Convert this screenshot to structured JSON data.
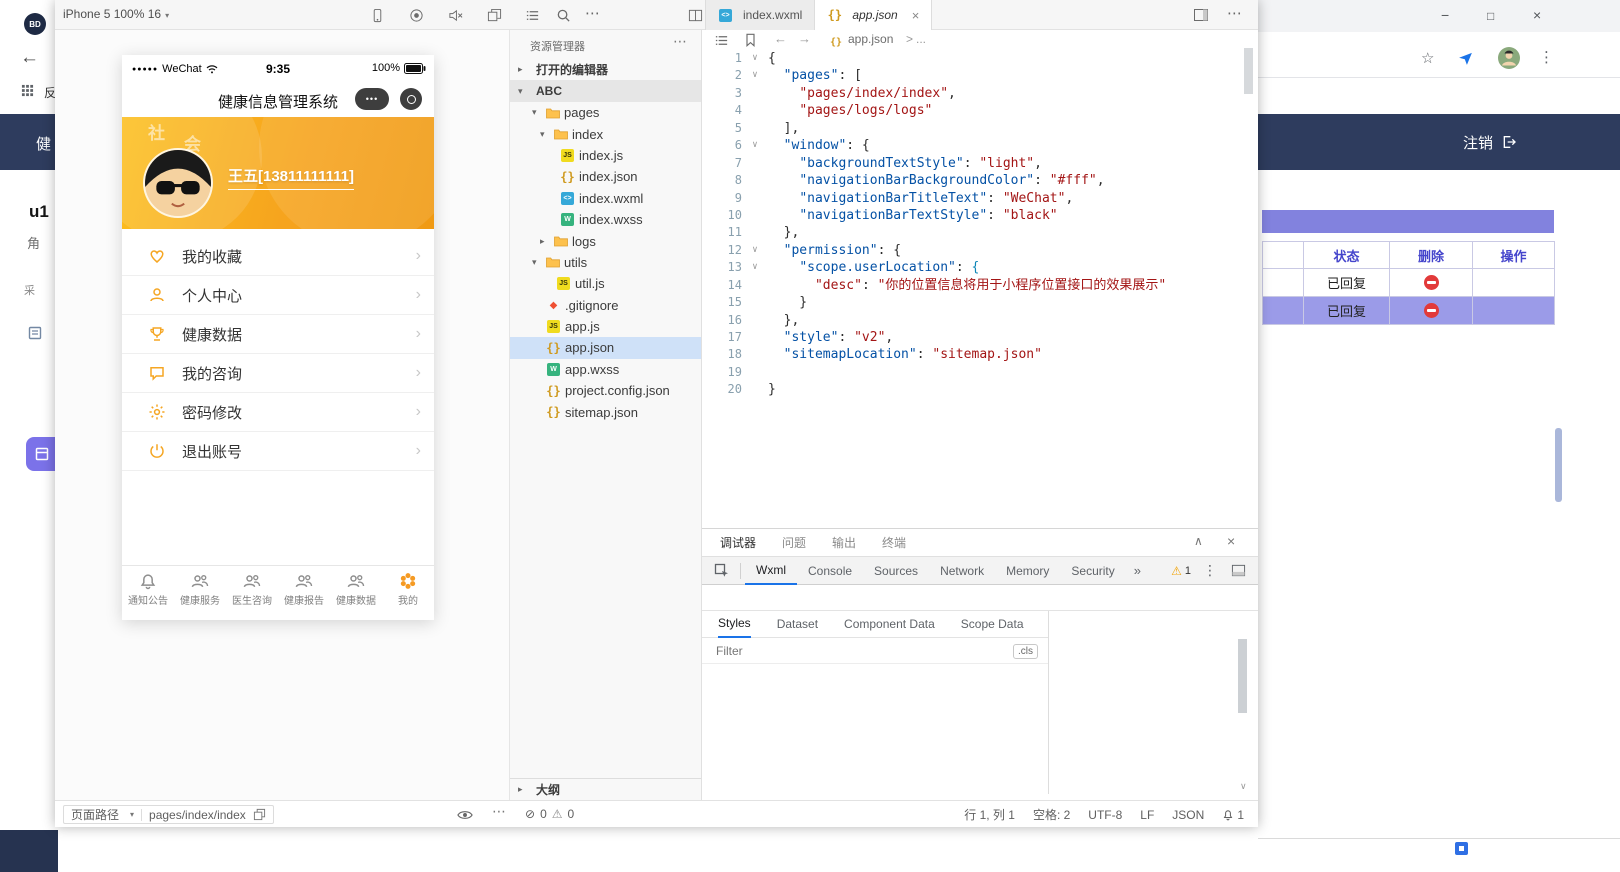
{
  "left_window": {
    "favicon_text": "BD",
    "bookmark_partial": "反",
    "page_header_partial": "健",
    "username_partial": "u1",
    "role_partial": "角",
    "small_partial": "采"
  },
  "topbar": {
    "device_selector": "iPhone 5 100% 16",
    "tabs": [
      {
        "label": "index.wxml",
        "type": "wxml",
        "active": false
      },
      {
        "label": "app.json",
        "type": "json",
        "active": true
      }
    ]
  },
  "simulator": {
    "status": {
      "carrier_dots": "●●●●●",
      "carrier": "WeChat",
      "time": "9:35",
      "battery": "100%"
    },
    "nav_title": "健康信息管理系统",
    "capsule_dots": "•••",
    "header": {
      "name": "王五[13811111111]",
      "decor1": "社",
      "decor2": "会"
    },
    "menu": [
      {
        "label": "我的收藏",
        "icon": "heart-icon"
      },
      {
        "label": "个人中心",
        "icon": "user-icon"
      },
      {
        "label": "健康数据",
        "icon": "trophy-icon"
      },
      {
        "label": "我的咨询",
        "icon": "chat-icon"
      },
      {
        "label": "密码修改",
        "icon": "gear-icon"
      },
      {
        "label": "退出账号",
        "icon": "power-icon"
      }
    ],
    "tabbar": [
      {
        "label": "通知公告",
        "icon": "bell-icon",
        "active": false
      },
      {
        "label": "健康服务",
        "icon": "people-icon",
        "active": false
      },
      {
        "label": "医生咨询",
        "icon": "people-icon",
        "active": false
      },
      {
        "label": "健康报告",
        "icon": "people-icon",
        "active": false
      },
      {
        "label": "健康数据",
        "icon": "people-icon",
        "active": false
      },
      {
        "label": "我的",
        "icon": "flower-icon",
        "active": true
      }
    ],
    "footer": {
      "path_label": "页面路径",
      "path_value": "pages/index/index"
    }
  },
  "explorer": {
    "title": "资源管理器",
    "open_editors": "打开的编辑器",
    "project": "ABC",
    "outline": "大纲",
    "tree": [
      {
        "label": "pages",
        "type": "folder",
        "indent": 22,
        "expanded": true
      },
      {
        "label": "index",
        "type": "folder",
        "indent": 30,
        "expanded": true
      },
      {
        "label": "index.js",
        "type": "js",
        "indent": 50
      },
      {
        "label": "index.json",
        "type": "json",
        "indent": 50
      },
      {
        "label": "index.wxml",
        "type": "wxml",
        "indent": 50
      },
      {
        "label": "index.wxss",
        "type": "wxss",
        "indent": 50
      },
      {
        "label": "logs",
        "type": "folder",
        "indent": 30,
        "expanded": false
      },
      {
        "label": "utils",
        "type": "folder",
        "indent": 22,
        "expanded": true
      },
      {
        "label": "util.js",
        "type": "js",
        "indent": 46
      },
      {
        "label": ".gitignore",
        "type": "git",
        "indent": 36
      },
      {
        "label": "app.js",
        "type": "js",
        "indent": 36
      },
      {
        "label": "app.json",
        "type": "json",
        "indent": 36,
        "selected": true
      },
      {
        "label": "app.wxss",
        "type": "wxss",
        "indent": 36
      },
      {
        "label": "project.config.json",
        "type": "json",
        "indent": 36
      },
      {
        "label": "sitemap.json",
        "type": "json",
        "indent": 36
      }
    ]
  },
  "editor": {
    "breadcrumb": {
      "file": "app.json",
      "sep": ">",
      "more": "..."
    },
    "code": [
      {
        "n": 1,
        "fold": true,
        "tokens": [
          [
            "p",
            "{"
          ]
        ]
      },
      {
        "n": 2,
        "fold": true,
        "tokens": [
          [
            "p",
            "  "
          ],
          [
            "k",
            "\"pages\""
          ],
          [
            "p",
            ": ["
          ]
        ]
      },
      {
        "n": 3,
        "fold": false,
        "tokens": [
          [
            "p",
            "    "
          ],
          [
            "s",
            "\"pages/index/index\""
          ],
          [
            "p",
            ","
          ]
        ]
      },
      {
        "n": 4,
        "fold": false,
        "tokens": [
          [
            "p",
            "    "
          ],
          [
            "s",
            "\"pages/logs/logs\""
          ]
        ]
      },
      {
        "n": 5,
        "fold": false,
        "tokens": [
          [
            "p",
            "  ],"
          ]
        ]
      },
      {
        "n": 6,
        "fold": true,
        "tokens": [
          [
            "p",
            "  "
          ],
          [
            "k",
            "\"window\""
          ],
          [
            "p",
            ": {"
          ]
        ]
      },
      {
        "n": 7,
        "fold": false,
        "tokens": [
          [
            "p",
            "    "
          ],
          [
            "k",
            "\"backgroundTextStyle\""
          ],
          [
            "p",
            ": "
          ],
          [
            "s",
            "\"light\""
          ],
          [
            "p",
            ","
          ]
        ]
      },
      {
        "n": 8,
        "fold": false,
        "tokens": [
          [
            "p",
            "    "
          ],
          [
            "k",
            "\"navigationBarBackgroundColor\""
          ],
          [
            "p",
            ": "
          ],
          [
            "s",
            "\"#fff\""
          ],
          [
            "p",
            ","
          ]
        ]
      },
      {
        "n": 9,
        "fold": false,
        "tokens": [
          [
            "p",
            "    "
          ],
          [
            "k",
            "\"navigationBarTitleText\""
          ],
          [
            "p",
            ": "
          ],
          [
            "s",
            "\"WeChat\""
          ],
          [
            "p",
            ","
          ]
        ]
      },
      {
        "n": 10,
        "fold": false,
        "tokens": [
          [
            "p",
            "    "
          ],
          [
            "k",
            "\"navigationBarTextStyle\""
          ],
          [
            "p",
            ": "
          ],
          [
            "s",
            "\"black\""
          ]
        ]
      },
      {
        "n": 11,
        "fold": false,
        "tokens": [
          [
            "p",
            "  },"
          ]
        ]
      },
      {
        "n": 12,
        "fold": true,
        "tokens": [
          [
            "p",
            "  "
          ],
          [
            "k",
            "\"permission\""
          ],
          [
            "p",
            ": {"
          ]
        ]
      },
      {
        "n": 13,
        "fold": true,
        "tokens": [
          [
            "p",
            "    "
          ],
          [
            "k",
            "\"scope.userLocation\""
          ],
          [
            "p",
            ": "
          ],
          [
            "b",
            "{"
          ]
        ]
      },
      {
        "n": 14,
        "fold": false,
        "tokens": [
          [
            "p",
            "      "
          ],
          [
            "s",
            "\"desc\""
          ],
          [
            "p",
            ": "
          ],
          [
            "s",
            "\"你的位置信息将用于小程序位置接口的效果展示\""
          ]
        ]
      },
      {
        "n": 15,
        "fold": false,
        "tokens": [
          [
            "p",
            "    }"
          ]
        ]
      },
      {
        "n": 16,
        "fold": false,
        "tokens": [
          [
            "p",
            "  },"
          ]
        ]
      },
      {
        "n": 17,
        "fold": false,
        "tokens": [
          [
            "p",
            "  "
          ],
          [
            "k",
            "\"style\""
          ],
          [
            "p",
            ": "
          ],
          [
            "s",
            "\"v2\""
          ],
          [
            "p",
            ","
          ]
        ]
      },
      {
        "n": 18,
        "fold": false,
        "tokens": [
          [
            "p",
            "  "
          ],
          [
            "k",
            "\"sitemapLocation\""
          ],
          [
            "p",
            ": "
          ],
          [
            "s",
            "\"sitemap.json\""
          ]
        ]
      },
      {
        "n": 19,
        "fold": false,
        "tokens": []
      },
      {
        "n": 20,
        "fold": false,
        "tokens": [
          [
            "p",
            "}"
          ]
        ]
      }
    ]
  },
  "debug": {
    "tabs": [
      {
        "label": "调试器",
        "active": true
      },
      {
        "label": "问题",
        "active": false
      },
      {
        "label": "输出",
        "active": false
      },
      {
        "label": "终端",
        "active": false
      }
    ],
    "devtools_tabs": [
      {
        "label": "Wxml",
        "active": true
      },
      {
        "label": "Console",
        "active": false
      },
      {
        "label": "Sources",
        "active": false
      },
      {
        "label": "Network",
        "active": false
      },
      {
        "label": "Memory",
        "active": false
      },
      {
        "label": "Security",
        "active": false
      }
    ],
    "overflow": "»",
    "warning_count": "1",
    "subtabs": [
      {
        "label": "Styles",
        "active": true
      },
      {
        "label": "Dataset",
        "active": false
      },
      {
        "label": "Component Data",
        "active": false
      },
      {
        "label": "Scope Data",
        "active": false
      }
    ],
    "filter_placeholder": "Filter",
    "cls": ".cls"
  },
  "statusbar": {
    "errors": "0",
    "warnings": "0",
    "cursor": "行 1, 列 1",
    "spaces": "空格: 2",
    "encoding": "UTF-8",
    "eol": "LF",
    "language": "JSON",
    "bell_count": "1"
  },
  "browser": {
    "logout": "注销",
    "table": {
      "headers": [
        "状态",
        "删除",
        "操作"
      ],
      "rows": [
        {
          "status": "已回复",
          "selected": false
        },
        {
          "status": "已回复",
          "selected": true
        }
      ]
    }
  }
}
